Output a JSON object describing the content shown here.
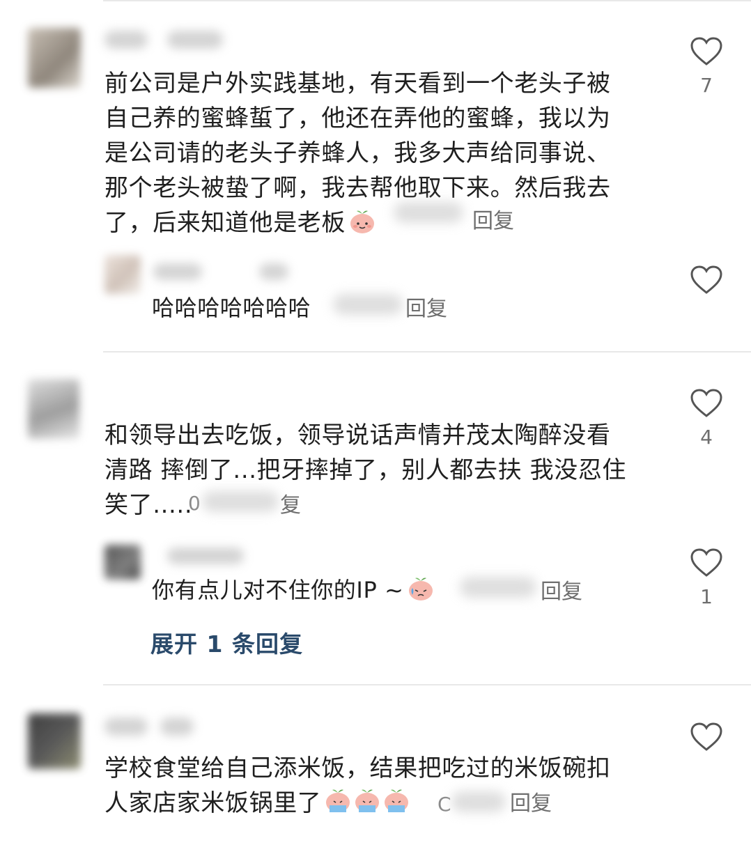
{
  "comments": [
    {
      "text_lines": [
        "前公司是户外实践基地，有天看到一个老头子被",
        "自己养的蜜蜂蜇了，他还在弄他的蜜蜂，我以为",
        "是公司请的老头子养蜂人，我多大声给同事说、",
        "那个老头被蛰了啊，我去帮他取下来。然后我去",
        "了，后来知道他是老板"
      ],
      "reply_label": "回复",
      "likes": "7",
      "sub": {
        "text": "哈哈哈哈哈哈哈",
        "reply_label": "回复",
        "likes": ""
      }
    },
    {
      "text_lines": [
        "和领导出去吃饭，领导说话声情并茂太陶醉没看",
        "清路 摔倒了...把牙摔掉了，别人都去扶 我没忍住",
        "笑了....."
      ],
      "frag_a": "0",
      "frag_b": "复",
      "likes": "4",
      "sub": {
        "text": "你有点儿对不住你的IP ~",
        "reply_label": "回复",
        "likes": "1"
      },
      "expand_label": "展开 1 条回复"
    },
    {
      "text_lines": [
        "学校食堂给自己添米饭，结果把吃过的米饭碗扣",
        "人家店家米饭锅里了"
      ],
      "frag": "C",
      "reply_label": "回复",
      "likes": ""
    }
  ],
  "icons": {
    "like": "heart-outline-icon",
    "emoji_smile": "peach-smile-emoji",
    "emoji_cry": "peach-cry-emoji",
    "emoji_sweat": "peach-sweat-emoji"
  },
  "colors": {
    "text": "#1f1f1f",
    "meta": "#6e6e6e",
    "link": "#2a4a6b",
    "divider": "#e8e8e8"
  }
}
